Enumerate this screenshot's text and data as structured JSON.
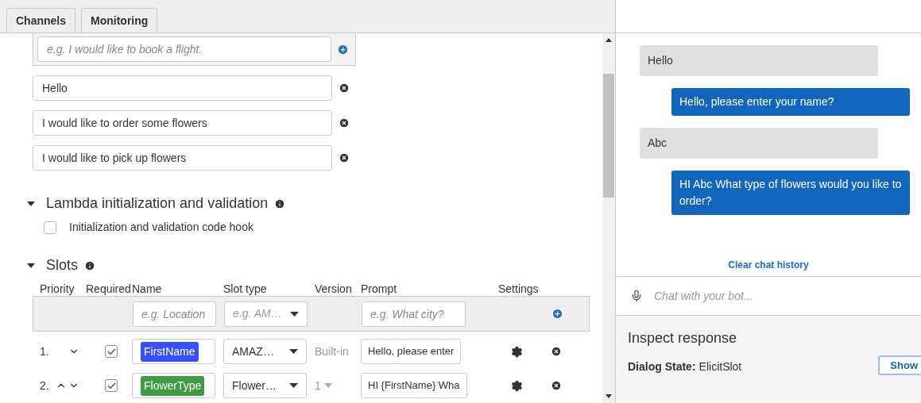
{
  "tabs": [
    {
      "label": "Channels",
      "selected": false
    },
    {
      "label": "Monitoring",
      "selected": false
    }
  ],
  "utterances": {
    "placeholder": "e.g. I would like to book a flight.",
    "items": [
      "Hello",
      "I would like to order some flowers",
      "I would like to pick up flowers"
    ]
  },
  "lambda_section": {
    "title": "Lambda initialization and validation",
    "expanded": true,
    "code_hook": {
      "label": "Initialization and validation code hook",
      "checked": false
    }
  },
  "slots_section": {
    "title": "Slots",
    "expanded": true,
    "columns": [
      "Priority",
      "Required",
      "Name",
      "Slot type",
      "Version",
      "Prompt",
      "Settings"
    ],
    "new_slot": {
      "name_placeholder": "e.g. Location",
      "type_placeholder": "e.g. AM…",
      "prompt_placeholder": "e.g. What city?"
    },
    "rows": [
      {
        "priority": "1.",
        "can_move_up": false,
        "can_move_down": true,
        "required": true,
        "name": "FirstName",
        "color": "#3550f5",
        "slot_type": "AMAZ…",
        "version": "Built-in",
        "prompt": "Hello, please enter"
      },
      {
        "priority": "2.",
        "can_move_up": true,
        "can_move_down": true,
        "required": true,
        "name": "FlowerType",
        "color": "#3f9c44",
        "slot_type": "Flower…",
        "version": "1",
        "prompt": "HI {FirstName} Wha"
      }
    ]
  },
  "chat": {
    "messages": [
      {
        "kind": "user",
        "text": "Hello"
      },
      {
        "kind": "bot",
        "text": "Hello, please enter your name?"
      },
      {
        "kind": "user",
        "text": "Abc"
      },
      {
        "kind": "bot",
        "text": "HI Abc What type of flowers would you like to order?"
      }
    ],
    "clear_link": "Clear chat history",
    "input_placeholder": "Chat with your bot..."
  },
  "inspect": {
    "title": "Inspect response",
    "dialog_state_label": "Dialog State:",
    "dialog_state": "ElicitSlot",
    "show_button": "Show"
  }
}
